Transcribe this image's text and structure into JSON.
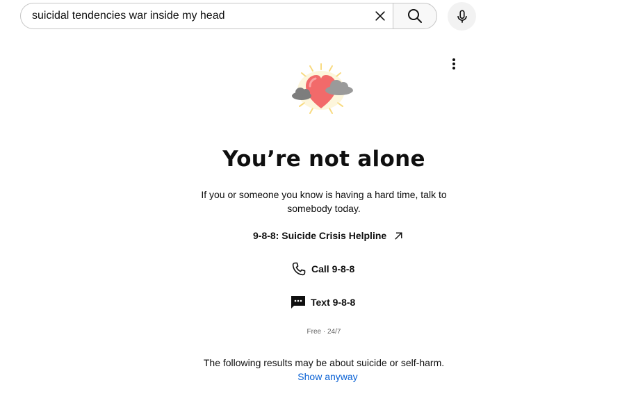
{
  "search": {
    "value": "suicidal tendencies war inside my head",
    "placeholder": "Search"
  },
  "icons": {
    "clear": "close-icon",
    "search": "search-icon",
    "mic": "microphone-icon",
    "more": "more-vert-icon",
    "illustration": "heart-with-clouds-icon",
    "external": "external-link-arrow-icon",
    "phone": "phone-icon",
    "message": "message-icon"
  },
  "crisis": {
    "headline": "You’re not alone",
    "subtext": "If you or someone you know is having a hard time, talk to somebody today.",
    "helpline": "9-8-8: Suicide Crisis Helpline",
    "call_label": "Call 9-8-8",
    "text_label": "Text 9-8-8",
    "availability": "Free · 24/7"
  },
  "results_warning": {
    "text": "The following results may be about suicide or self-harm.",
    "show_anyway": "Show anyway"
  },
  "colors": {
    "link": "#065fd4",
    "heart": "#f26a6a",
    "cloud": "#8a8a8a",
    "sunburst": "#f7d46a"
  }
}
